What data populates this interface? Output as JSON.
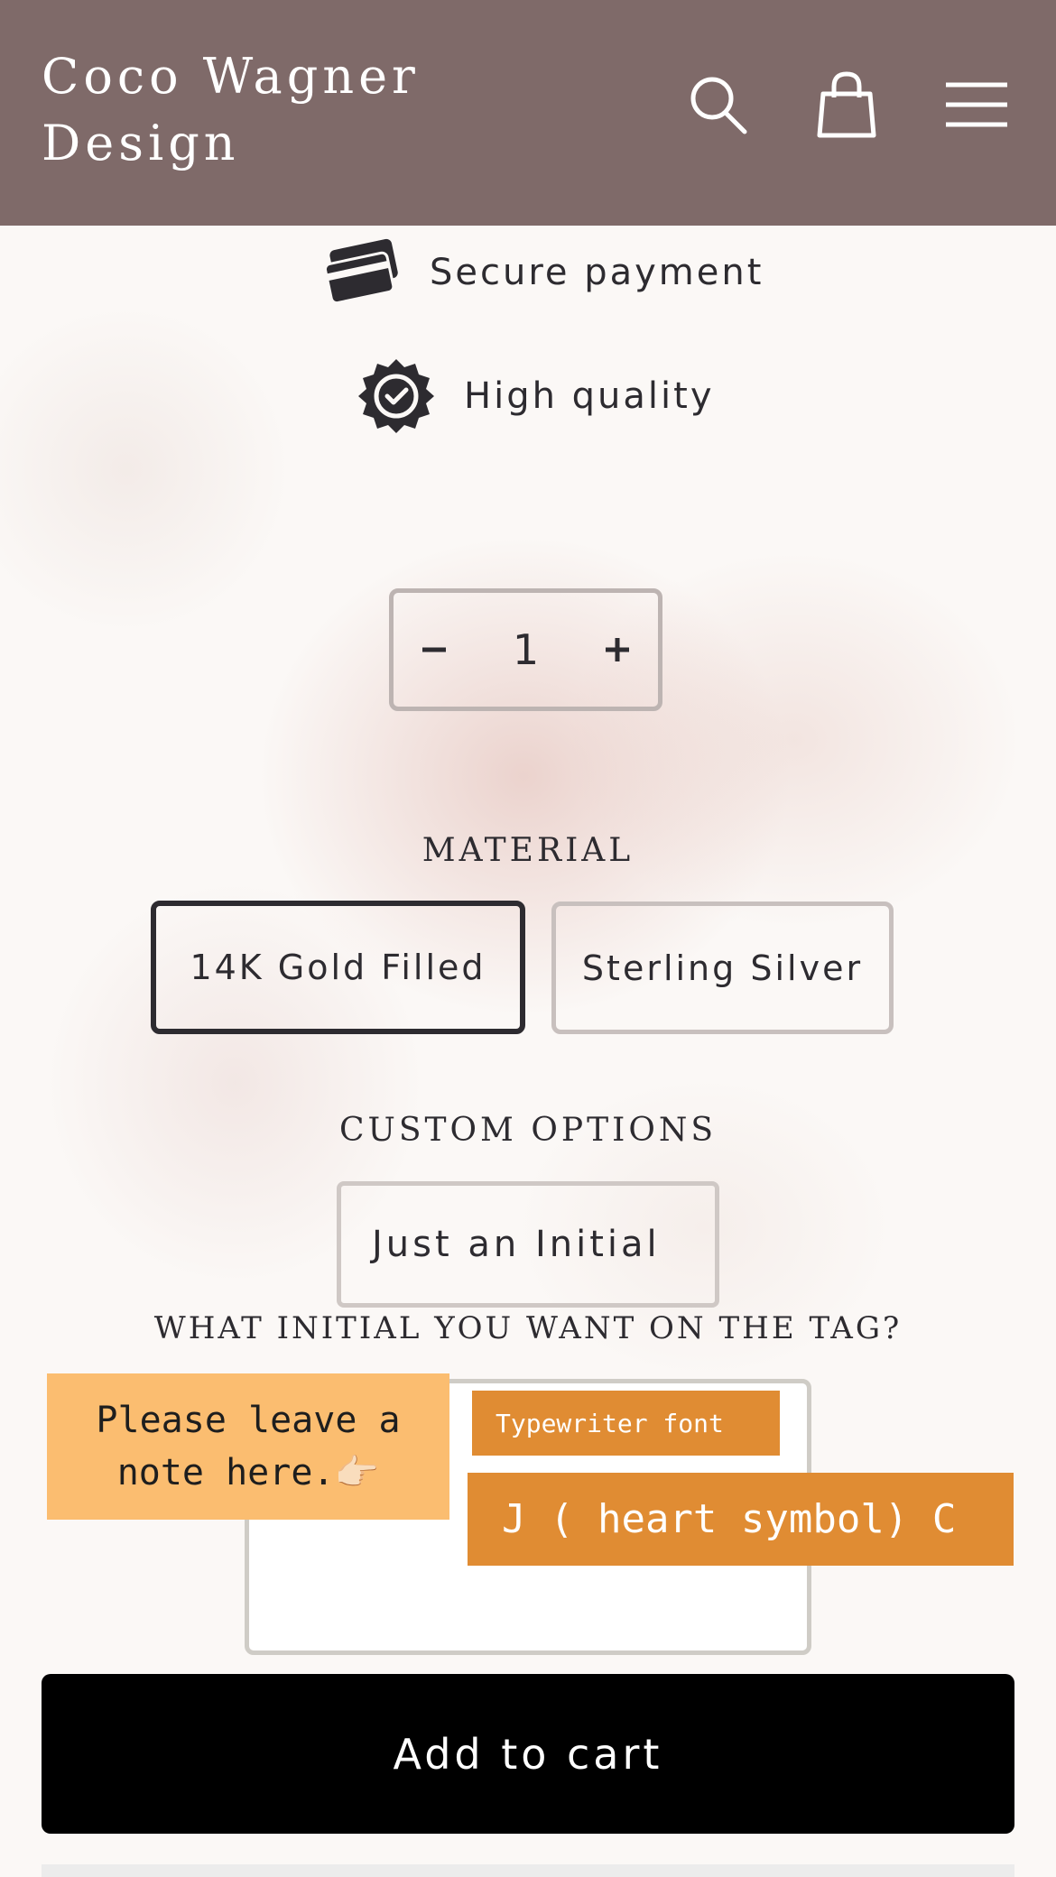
{
  "header": {
    "brand": "Coco Wagner Design",
    "background_color": "#7f6a69",
    "icons": [
      "search-icon",
      "cart-icon",
      "menu-icon"
    ]
  },
  "features": {
    "secure_payment": "Secure payment",
    "high_quality": "High quality"
  },
  "quantity": {
    "minus": "−",
    "value": "1",
    "plus": "+"
  },
  "material": {
    "label": "MATERIAL",
    "options": [
      "14K Gold Filled",
      "Sterling Silver"
    ],
    "selected": "14K Gold Filled"
  },
  "custom_options": {
    "label": "CUSTOM OPTIONS",
    "selected_value": "Just an Initial"
  },
  "initial_question": {
    "label": "WHAT INITIAL YOU WANT ON THE TAG?"
  },
  "overlays": {
    "sticky_note": "Please leave a note here.👉🏻",
    "font_tag": "Typewriter font",
    "example_tag": "J ( heart symbol) C",
    "accent_color": "#e08c33",
    "sticky_color": "#fbbd70"
  },
  "cart": {
    "add_to_cart": "Add to cart"
  }
}
